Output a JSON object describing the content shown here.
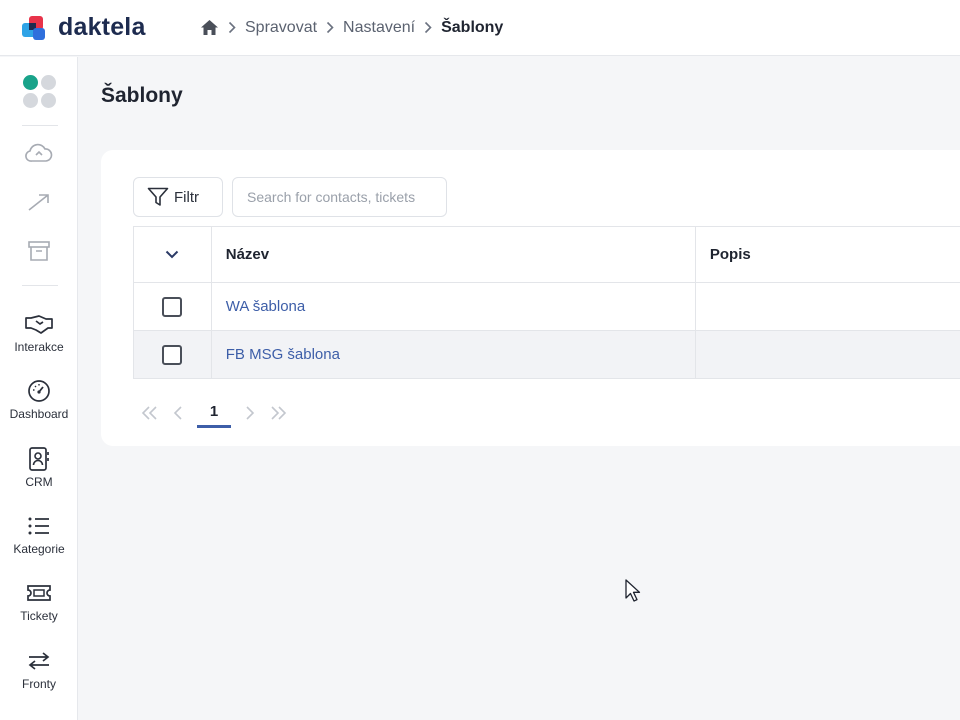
{
  "app": {
    "brand": "daktela"
  },
  "breadcrumb": {
    "items": [
      "Spravovat",
      "Nastavení"
    ],
    "current": "Šablony"
  },
  "nav": {
    "items": [
      {
        "label": "Interakce",
        "icon": "handshake-icon"
      },
      {
        "label": "Dashboard",
        "icon": "gauge-icon"
      },
      {
        "label": "CRM",
        "icon": "contact-book-icon"
      },
      {
        "label": "Kategorie",
        "icon": "list-icon"
      },
      {
        "label": "Tickety",
        "icon": "ticket-icon"
      },
      {
        "label": "Fronty",
        "icon": "transfer-arrows-icon"
      }
    ]
  },
  "page": {
    "title": "Šablony"
  },
  "toolbar": {
    "filter_label": "Filtr",
    "search_placeholder": "Search for contacts, tickets"
  },
  "table": {
    "headers": {
      "name": "Název",
      "description": "Popis"
    },
    "rows": [
      {
        "name": "WA šablona",
        "description": ""
      },
      {
        "name": "FB MSG šablona",
        "description": ""
      }
    ]
  },
  "pagination": {
    "current_page": "1"
  },
  "colors": {
    "accent": "#3d5ea8",
    "brand_red": "#e8334a",
    "brand_blue": "#2f6fdc",
    "brand_teal": "#19a38a"
  }
}
